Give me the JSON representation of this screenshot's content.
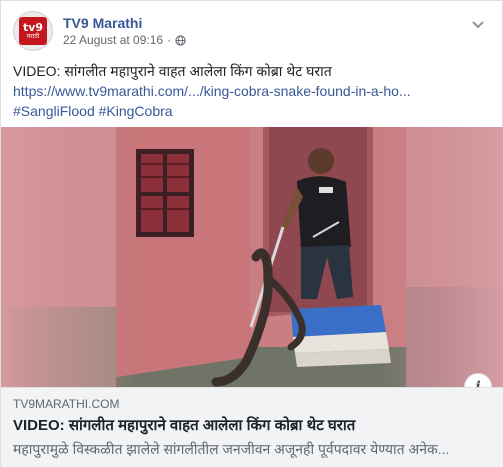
{
  "post": {
    "page_name": "TV9 Marathi",
    "timestamp": "22 August at 09:16",
    "separator": "·",
    "avatar_logo_main": "tv9",
    "avatar_logo_sub": "मराठी",
    "text_line1": "VIDEO: सांगलीत महापुराने वाहत आलेला किंग कोब्रा थेट घरात",
    "url": "https://www.tv9marathi.com/.../king-cobra-snake-found-in-a-ho...",
    "hashtags": "#SangliFlood #KingCobra"
  },
  "link_preview": {
    "domain": "TV9MARATHI.COM",
    "title": "VIDEO: सांगलीत महापुराने वाहत आलेला किंग कोब्रा थेट घरात",
    "description": "महापुरामुळे विस्कळीत झालेले सांगलीतील जनजीवन अजूनही पूर्वपदावर येण्यात अनेक...",
    "info_label": "i"
  },
  "icons": {
    "privacy": "globe-icon",
    "menu": "chevron-down-icon",
    "info": "info-icon"
  },
  "colors": {
    "link": "#385898",
    "wall": "#c9868a",
    "brand": "#c4161c"
  }
}
